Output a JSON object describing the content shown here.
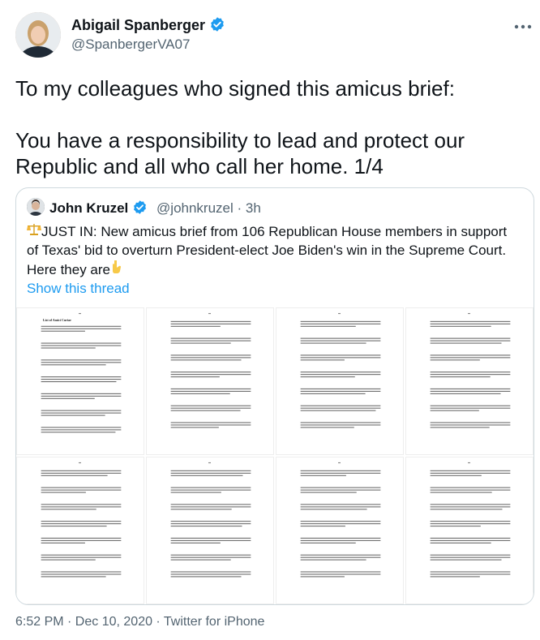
{
  "tweet": {
    "author_name": "Abigail Spanberger",
    "author_handle": "@SpanbergerVA07",
    "text": "To my colleagues who signed this amicus brief:\n\nYou have a responsibility to lead and protect our Republic and all who call her home. 1/4",
    "timestamp": "6:52 PM · Dec 10, 2020 · Twitter for iPhone",
    "more_icon": "more-horizontal-icon"
  },
  "quoted": {
    "author_name": "John Kruzel",
    "author_handle": "@johnkruzel",
    "age": "· 3h",
    "text_prefix": "JUST IN: New amicus brief from 106 Republican House members in support of Texas' bid to overturn President-elect Joe Biden's win in the Supreme Court. Here they are",
    "show_thread": "Show this thread",
    "page_heading": "List of Amici Curiae"
  },
  "colors": {
    "accent": "#1d9bf0",
    "verified": "#1d9bf0",
    "border": "#cfd9de",
    "secondary_text": "#536471"
  }
}
